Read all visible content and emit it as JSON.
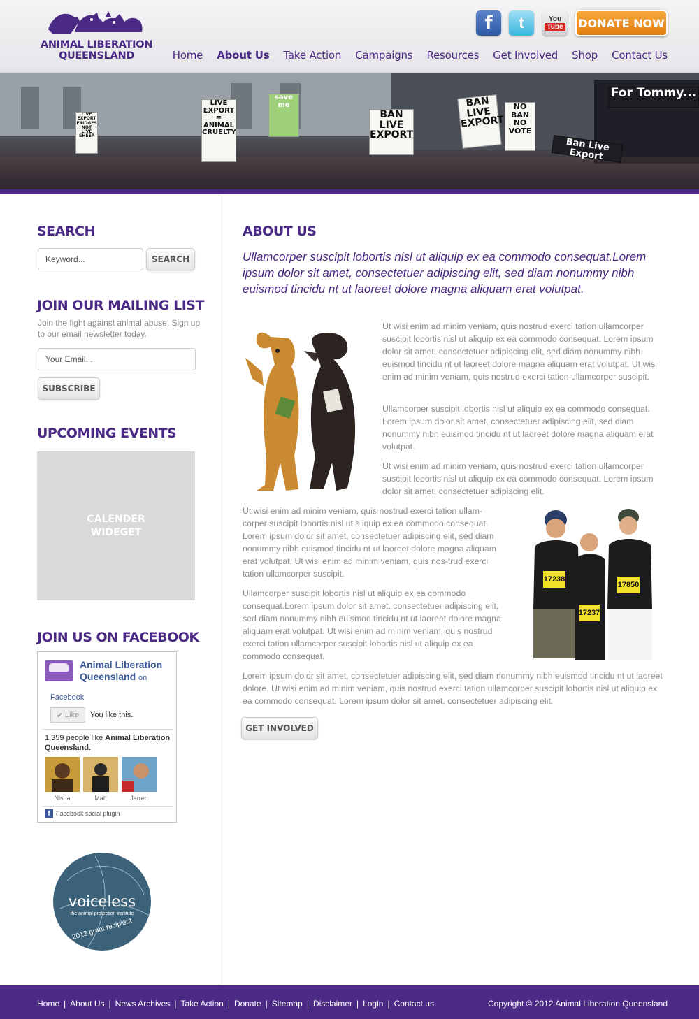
{
  "brand": {
    "line1": "ANIMAL LIBERATION",
    "line2": "QUEENSLAND",
    "color": "#4b2a86"
  },
  "social": [
    {
      "name": "facebook",
      "icon": "facebook-icon",
      "glyph": "f"
    },
    {
      "name": "twitter",
      "icon": "twitter-icon",
      "glyph": "t"
    },
    {
      "name": "youtube",
      "icon": "youtube-icon",
      "top": "You",
      "bottom": "Tube"
    }
  ],
  "donate_label": "DONATE NOW",
  "nav": [
    "Home",
    "About Us",
    "Take Action",
    "Campaigns",
    "Resources",
    "Get Involved",
    "Shop",
    "Contact Us"
  ],
  "nav_active": "About Us",
  "banner": {
    "signs": [
      "LIVE EXPORT = ANIMAL CRUELTY",
      "save me",
      "BAN LIVE EXPORT",
      "BAN LIVE EXPORT",
      "NO BAN NO VOTE",
      "For Tommy...",
      "Ban Live Export",
      "LIVE EXPORT FRIDGES NOT LIVE SHEEP"
    ]
  },
  "sidebar": {
    "search_title": "SEARCH",
    "search_placeholder": "Keyword...",
    "search_button": "SEARCH",
    "mailing_title": "JOIN OUR MAILING LIST",
    "mailing_text": "Join the fight against animal abuse. Sign up to our email newsletter today.",
    "email_placeholder": "Your Email...",
    "subscribe_button": "SUBSCRIBE",
    "events_title": "UPCOMING EVENTS",
    "calendar_line1": "CALENDER",
    "calendar_line2": "WIDEGET",
    "facebook_title": "JOIN US ON FACEBOOK",
    "fb": {
      "page_name": "Animal Liberation Queensland",
      "on": "on",
      "facebook": "Facebook",
      "like": "Like",
      "you_like": "You like this.",
      "count_text": "1,359 people like",
      "count_name": "Animal Liberation Queensland.",
      "friends": [
        "Nisha",
        "Matt",
        "Jarren"
      ],
      "plugin": "Facebook social plugin"
    },
    "voiceless": {
      "word": "voiceless",
      "sub": "the animal protection institute",
      "grant": "2012 grant recipient"
    }
  },
  "main": {
    "title": "ABOUT US",
    "lead": "Ullamcorper suscipit lobortis nisl ut aliquip ex ea commodo consequat.Lorem ipsum dolor sit amet, consectetuer adipiscing elit, sed diam nonummy nibh euismod tincidu nt ut laoreet dolore magna aliquam erat volutpat.",
    "p1": "Ut wisi enim ad minim veniam, quis nostrud exerci tation ullamcorper suscipit lobortis nisl ut aliquip ex ea commodo consequat. Lorem ipsum dolor sit amet, consectetuer adipiscing elit, sed diam nonummy nibh euismod tincidu nt ut laoreet dolore magna aliquam erat volutpat. Ut wisi enim ad minim veniam, quis nostrud exerci tation ullamcorper suscipit.",
    "p2": "Ullamcorper suscipit lobortis nisl ut aliquip ex ea commodo consequat. Lorem ipsum dolor sit amet, consectetuer adipiscing elit, sed diam nonummy nibh euismod tincidu nt ut laoreet dolore magna aliquam erat volutpat.",
    "p3": "Ut wisi enim ad minim veniam, quis nostrud exerci tation ullamcorper suscipit lobortis nisl ut aliquip ex ea commodo consequat. Lorem ipsum dolor sit amet, consectetuer adipiscing elit.",
    "p4": "Ut wisi enim ad minim veniam, quis nostrud exerci tation ullam-corper suscipit lobortis nisl ut aliquip ex ea commodo consequat. Lorem ipsum dolor sit amet, consectetuer adipiscing elit, sed diam nonummy nibh euismod tincidu nt ut laoreet dolore magna aliquam erat volutpat. Ut wisi enim ad minim veniam, quis nos-trud exerci tation ullamcorper suscipit.",
    "p5": "Ullamcorper suscipit lobortis nisl ut aliquip ex ea commodo consequat.Lorem ipsum dolor sit amet, consectetuer adipiscing elit, sed diam nonummy nibh euismod tincidu nt ut laoreet dolore magna aliquam erat volutpat. Ut wisi enim ad minim veniam, quis nostrud exerci tation ullamcorper suscipit lobortis nisl ut aliquip ex ea commodo consequat.",
    "p6": "Lorem ipsum dolor sit amet, consectetuer adipiscing elit, sed diam nonummy nibh euismod tincidu nt ut laoreet dolore. Ut wisi enim ad minim veniam, quis nostrud exerci tation ullamcorper suscipit lobortis nisl ut aliquip ex ea commodo consequat. Lorem ipsum dolor sit amet, consectetuer adipiscing elit.",
    "bibs": [
      "17238",
      "17237",
      "17850"
    ],
    "get_involved": "GET INVOLVED"
  },
  "footer": {
    "links": [
      "Home",
      "About Us",
      "News Archives",
      "Take Action",
      "Donate",
      "Sitemap",
      "Disclaimer",
      "Login",
      "Contact us"
    ],
    "copyright": "Copyright © 2012 Animal Liberation Queensland"
  }
}
